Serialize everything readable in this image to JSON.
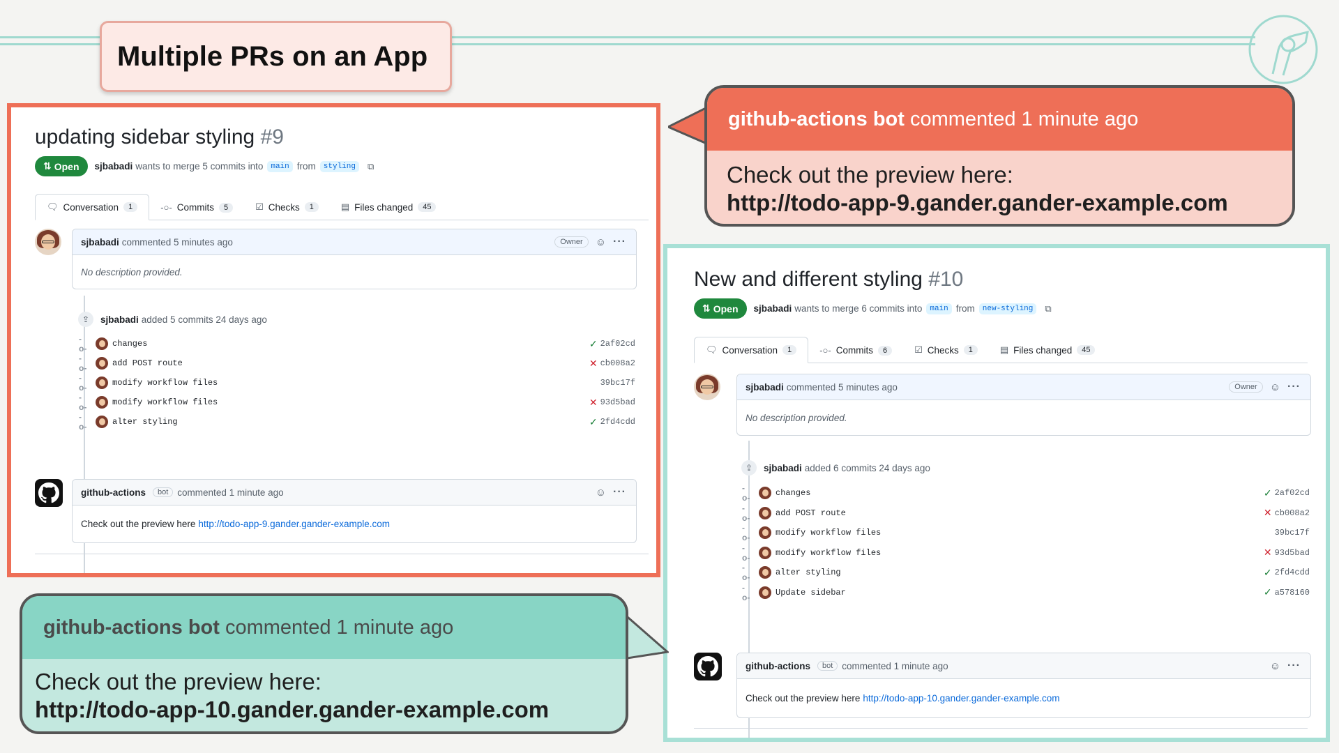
{
  "slide": {
    "title": "Multiple PRs on an App"
  },
  "pr_a": {
    "title": "updating sidebar styling",
    "number": "#9",
    "status": "Open",
    "author": "sjbabadi",
    "merge_text": "wants to merge 5 commits into",
    "base": "main",
    "from_text": "from",
    "head": "styling",
    "tabs": [
      {
        "label": "Conversation",
        "count": "1"
      },
      {
        "label": "Commits",
        "count": "5"
      },
      {
        "label": "Checks",
        "count": "1"
      },
      {
        "label": "Files changed",
        "count": "45"
      }
    ],
    "comment1": {
      "author": "sjbabadi",
      "meta": "commented 5 minutes ago",
      "role": "Owner",
      "body": "No description provided."
    },
    "commits_header": {
      "author": "sjbabadi",
      "text": "added 5 commits 24 days ago"
    },
    "commits": [
      {
        "message": "changes",
        "status": "success",
        "sha": "2af02cd"
      },
      {
        "message": "add POST route",
        "status": "failure",
        "sha": "cb008a2"
      },
      {
        "message": "modify workflow files",
        "status": "none",
        "sha": "39bc17f"
      },
      {
        "message": "modify workflow files",
        "status": "failure",
        "sha": "93d5bad"
      },
      {
        "message": "alter styling",
        "status": "success",
        "sha": "2fd4cdd"
      }
    ],
    "bot_comment": {
      "author": "github-actions",
      "tag": "bot",
      "meta": "commented 1 minute ago",
      "body": "Check out the preview here",
      "link": "http://todo-app-9.gander.gander-example.com"
    }
  },
  "pr_b": {
    "title": "New and different styling",
    "number": "#10",
    "status": "Open",
    "author": "sjbabadi",
    "merge_text": "wants to merge 6 commits into",
    "base": "main",
    "from_text": "from",
    "head": "new-styling",
    "tabs": [
      {
        "label": "Conversation",
        "count": "1"
      },
      {
        "label": "Commits",
        "count": "6"
      },
      {
        "label": "Checks",
        "count": "1"
      },
      {
        "label": "Files changed",
        "count": "45"
      }
    ],
    "comment1": {
      "author": "sjbabadi",
      "meta": "commented 5 minutes ago",
      "role": "Owner",
      "body": "No description provided."
    },
    "commits_header": {
      "author": "sjbabadi",
      "text": "added 6 commits 24 days ago"
    },
    "commits": [
      {
        "message": "changes",
        "status": "success",
        "sha": "2af02cd"
      },
      {
        "message": "add POST route",
        "status": "failure",
        "sha": "cb008a2"
      },
      {
        "message": "modify workflow files",
        "status": "none",
        "sha": "39bc17f"
      },
      {
        "message": "modify workflow files",
        "status": "failure",
        "sha": "93d5bad"
      },
      {
        "message": "alter styling",
        "status": "success",
        "sha": "2fd4cdd"
      },
      {
        "message": "Update sidebar",
        "status": "success",
        "sha": "a578160"
      }
    ],
    "bot_comment": {
      "author": "github-actions",
      "tag": "bot",
      "meta": "commented 1 minute ago",
      "body": "Check out the preview here",
      "link": "http://todo-app-10.gander.gander-example.com"
    }
  },
  "callout_a": {
    "author": "github-actions bot",
    "meta": "commented 1 minute ago",
    "line1": "Check out the preview here:",
    "line2": "http://todo-app-9.gander.gander-example.com"
  },
  "callout_b": {
    "author": "github-actions bot",
    "meta": "commented 1 minute ago",
    "line1": "Check out the preview here:",
    "line2": "http://todo-app-10.gander.gander-example.com"
  },
  "colors": {
    "coral": "#ee6f57",
    "coral_light": "#f9d3cb",
    "teal": "#a8e0d6",
    "teal_header": "#88d5c5",
    "teal_light": "#c3e8df",
    "open_green": "#1f883d",
    "link_blue": "#0969da"
  },
  "icons": [
    "logo-icon",
    "pull-request-icon",
    "copy-icon",
    "conversation-icon",
    "commits-icon",
    "checks-icon",
    "files-icon",
    "smiley-icon",
    "kebab-icon",
    "github-icon",
    "check-icon",
    "x-icon"
  ]
}
